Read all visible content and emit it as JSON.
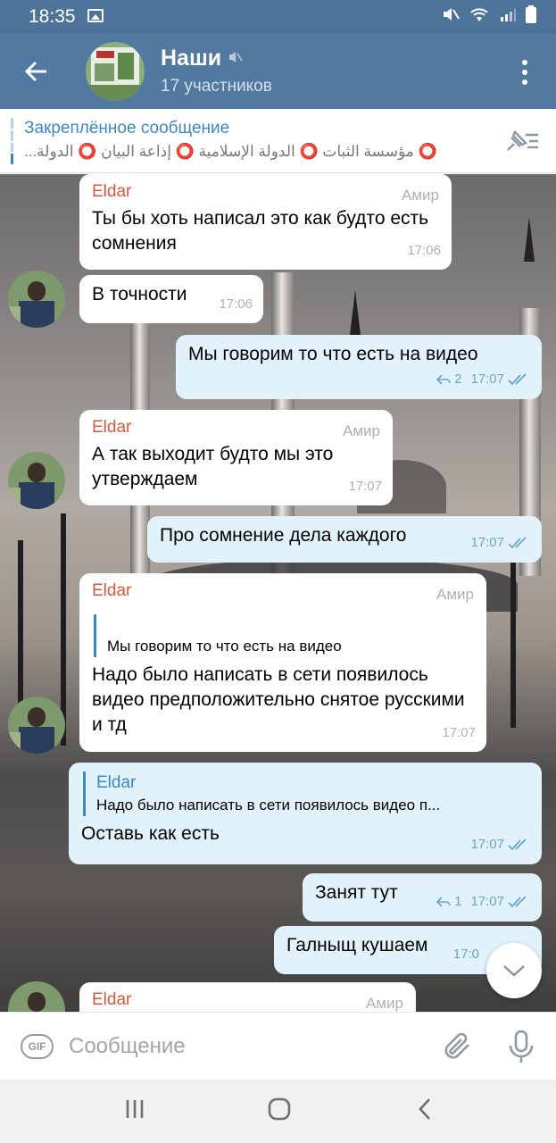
{
  "status_bar": {
    "time": "18:35"
  },
  "header": {
    "title": "Наши",
    "subtitle": "17 участников"
  },
  "pinned": {
    "title": "Закреплённое сообщение",
    "text": "⭕ مؤسسة الثبات ⭕ الدولة الإسلامية ⭕ إذاعة البيان ⭕ الدولة..."
  },
  "messages": [
    {
      "sender": "Eldar",
      "role": "Амир",
      "text": "Ты бы хоть написал это как будто есть сомнения",
      "time": "17:06"
    },
    {
      "text": "В точности",
      "time": "17:06"
    },
    {
      "text": "Мы говорим то что есть на видео",
      "replies": "2",
      "time": "17:07"
    },
    {
      "sender": "Eldar",
      "role": "Амир",
      "text": "А так выходит будто мы это утверждаем",
      "time": "17:07"
    },
    {
      "text": "Про сомнение дела каждого",
      "time": "17:07"
    },
    {
      "sender": "Eldar",
      "role": "Амир",
      "quote_text": "Мы говорим то что есть на видео",
      "text": "Надо было написать в сети появилось видео предположительно снятое русскими и тд",
      "time": "17:07"
    },
    {
      "quote_name": "Eldar",
      "quote_text": "Надо было написать в сети появилось видео п...",
      "text": "Оставь как есть",
      "time": "17:07"
    },
    {
      "text": "Занят тут",
      "replies": "1",
      "time": "17:07"
    },
    {
      "text": "Галныщ кушаем",
      "time": "17:0"
    },
    {
      "sender": "Eldar",
      "role": "Амир"
    }
  ],
  "composer": {
    "gif_label": "GIF",
    "placeholder": "Сообщение"
  },
  "colors": {
    "header": "#52799f",
    "accent": "#3b88c5",
    "sender": "#d6593a",
    "outgoing_bubble": "#e2f2fb"
  }
}
